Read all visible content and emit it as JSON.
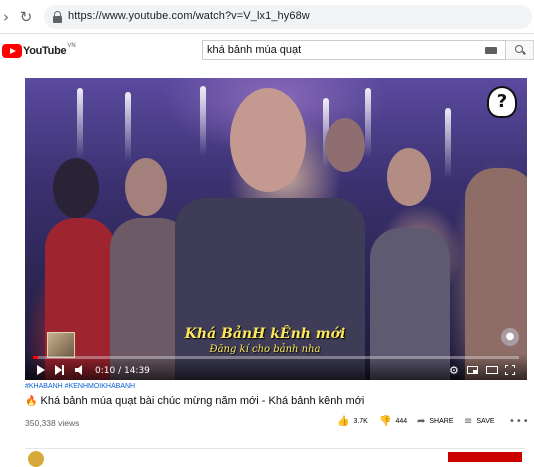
{
  "browser": {
    "url": "https://www.youtube.com/watch?v=V_lx1_hy68w"
  },
  "header": {
    "logo_text": "YouTube",
    "logo_country": "VN",
    "search_query": "khá bảnh múa quạt"
  },
  "player": {
    "caption_line1": "Khá BảnH kÊnh mới",
    "caption_line2": "Đăng kí cho bảnh nha",
    "corner_logo": "?",
    "time": "0:10 / 14:39",
    "progress": 0.011
  },
  "video": {
    "hashtags": "#KHABANH #KENHMOIKHABANH",
    "title": "Khá bảnh múa quạt bài chúc mừng năm mới - Khá bảnh kênh mới",
    "views": "350,338 views",
    "likes": "3.7K",
    "dislikes": "444",
    "share_label": "SHARE",
    "save_label": "SAVE"
  },
  "colors": {
    "brand": "#ff0000",
    "link": "#065fd4",
    "caption": "#ffe75a"
  }
}
